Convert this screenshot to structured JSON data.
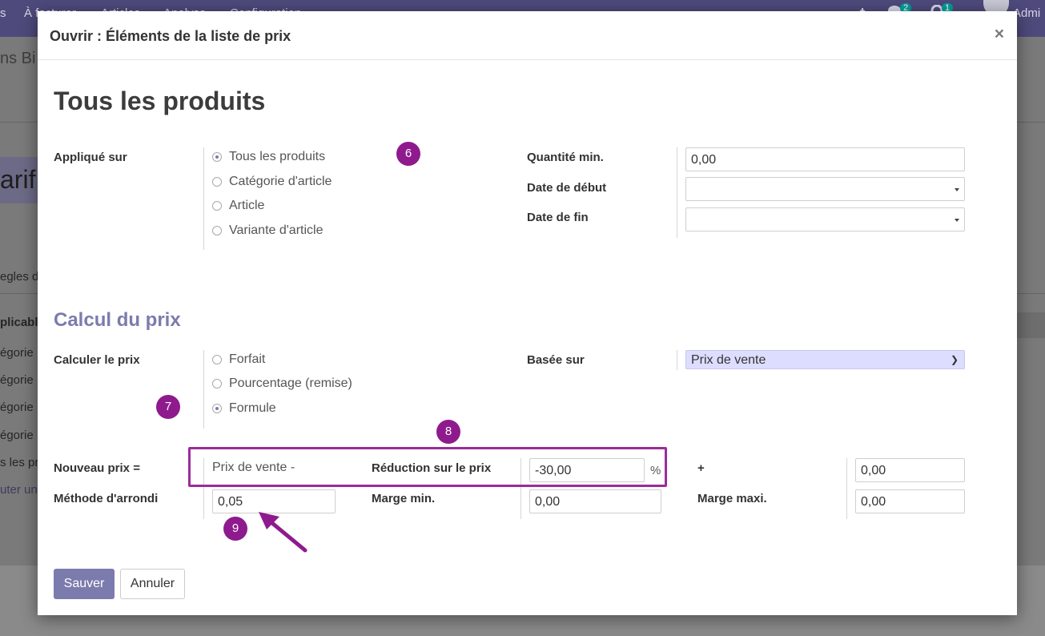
{
  "background": {
    "menu_items": [
      "s",
      "À facturer",
      "Articles",
      "Analyse",
      "Configuration"
    ],
    "chat_badge": "2",
    "activity_badge": "1",
    "user": "Admi",
    "breadcrumb": "ns Bi",
    "record_title": "arif l",
    "tab": "egles d",
    "column_header": "plicable",
    "rows": [
      "égorie",
      "égorie",
      "égorie",
      "égorie",
      "s les pr"
    ],
    "add_line": "uter une"
  },
  "modal": {
    "title": "Ouvrir : Éléments de la liste de prix",
    "close": "×",
    "product_title": "Tous les produits",
    "applied_on": {
      "label": "Appliqué sur",
      "options": [
        "Tous les produits",
        "Catégorie d'article",
        "Article",
        "Variante d'article"
      ],
      "selected": 0
    },
    "min_qty": {
      "label": "Quantité min.",
      "value": "0,00"
    },
    "date_start": {
      "label": "Date de début",
      "value": ""
    },
    "date_end": {
      "label": "Date de fin",
      "value": ""
    },
    "section_title": "Calcul du prix",
    "compute_price": {
      "label": "Calculer le prix",
      "options": [
        "Forfait",
        "Pourcentage (remise)",
        "Formule"
      ],
      "selected": 2
    },
    "based_on": {
      "label": "Basée sur",
      "value": "Prix de vente"
    },
    "new_price": {
      "label": "Nouveau prix =",
      "base_text": "Prix de vente -",
      "discount_label": "Réduction sur le prix",
      "discount_value": "-30,00",
      "percent": "%",
      "plus": "+",
      "surcharge_value": "0,00"
    },
    "rounding": {
      "label": "Méthode d'arrondi",
      "value": "0,05"
    },
    "min_margin": {
      "label": "Marge min.",
      "value": "0,00"
    },
    "max_margin": {
      "label": "Marge maxi.",
      "value": "0,00"
    },
    "save_label": "Sauver",
    "cancel_label": "Annuler"
  },
  "annotations": [
    "6",
    "7",
    "8",
    "9"
  ],
  "colors": {
    "accent": "#7c7bad",
    "annotation": "#8e1a8e",
    "select_bg": "#ddddff"
  }
}
